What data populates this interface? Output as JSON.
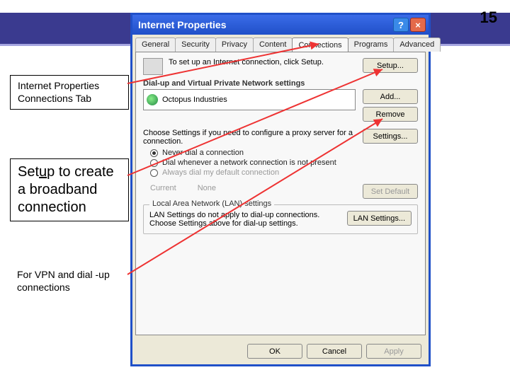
{
  "page_number": "15",
  "callouts": {
    "c1": "Internet Properties Connections Tab",
    "c2_pre": "Set",
    "c2_u": "u",
    "c2_post": "p to create a broadband connection",
    "c3": "For VPN and dial -up connections"
  },
  "dialog": {
    "title": "Internet Properties",
    "help": "?",
    "close": "×",
    "tabs": {
      "general": "General",
      "security": "Security",
      "privacy": "Privacy",
      "content": "Content",
      "connections": "Connections",
      "programs": "Programs",
      "advanced": "Advanced"
    },
    "setup_text": "To set up an Internet connection, click Setup.",
    "setup_btn": "Setup...",
    "group_dialup": "Dial-up and Virtual Private Network settings",
    "list_item": "Octopus Industries",
    "add_btn": "Add...",
    "remove_btn": "Remove",
    "proxy_text": "Choose Settings if you need to configure a proxy server for a connection.",
    "settings_btn": "Settings...",
    "radio_never": "Never dial a connection",
    "radio_when": "Dial whenever a network connection is not present",
    "radio_always": "Always dial my default connection",
    "current_label": "Current",
    "current_value": "None",
    "setdefault_btn": "Set Default",
    "lan_legend": "Local Area Network (LAN) settings",
    "lan_text": "LAN Settings do not apply to dial-up connections. Choose Settings above for dial-up settings.",
    "lan_btn": "LAN Settings...",
    "ok": "OK",
    "cancel": "Cancel",
    "apply": "Apply"
  }
}
